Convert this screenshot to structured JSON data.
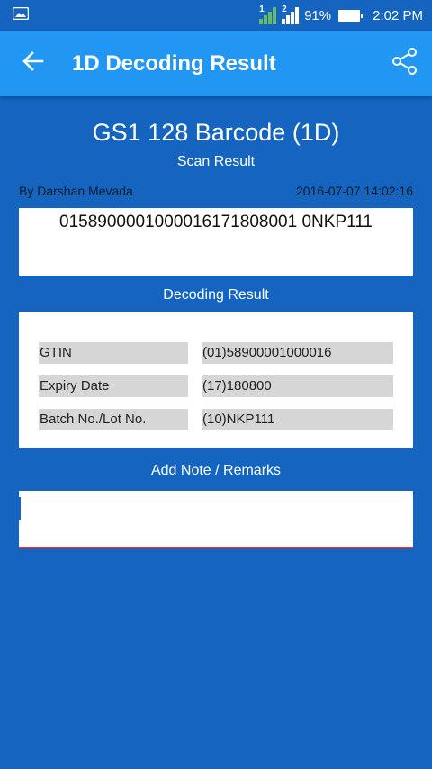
{
  "status_bar": {
    "sim1_label": "1",
    "sim2_label": "2",
    "battery_percent": "91%",
    "time": "2:02 PM"
  },
  "app_bar": {
    "title": "1D Decoding Result"
  },
  "header": {
    "title": "GS1 128 Barcode (1D)",
    "subtitle": "Scan Result"
  },
  "scan": {
    "author": "By Darshan Mevada",
    "timestamp": "2016-07-07 14:02:16",
    "raw_value": "0158900001000016171808001 0NKP111"
  },
  "decoding": {
    "label": "Decoding Result",
    "rows": [
      {
        "key": "GTIN",
        "value": "(01)58900001000016"
      },
      {
        "key": "Expiry Date",
        "value": "(17)180800"
      },
      {
        "key": "Batch No./Lot No.",
        "value": "(10)NKP111"
      }
    ]
  },
  "note": {
    "label": "Add Note / Remarks",
    "value": ""
  },
  "colors": {
    "background": "#1565c0",
    "app_bar": "#2196f3",
    "cell_background": "#d6d6d6",
    "input_underline": "#e53935"
  }
}
